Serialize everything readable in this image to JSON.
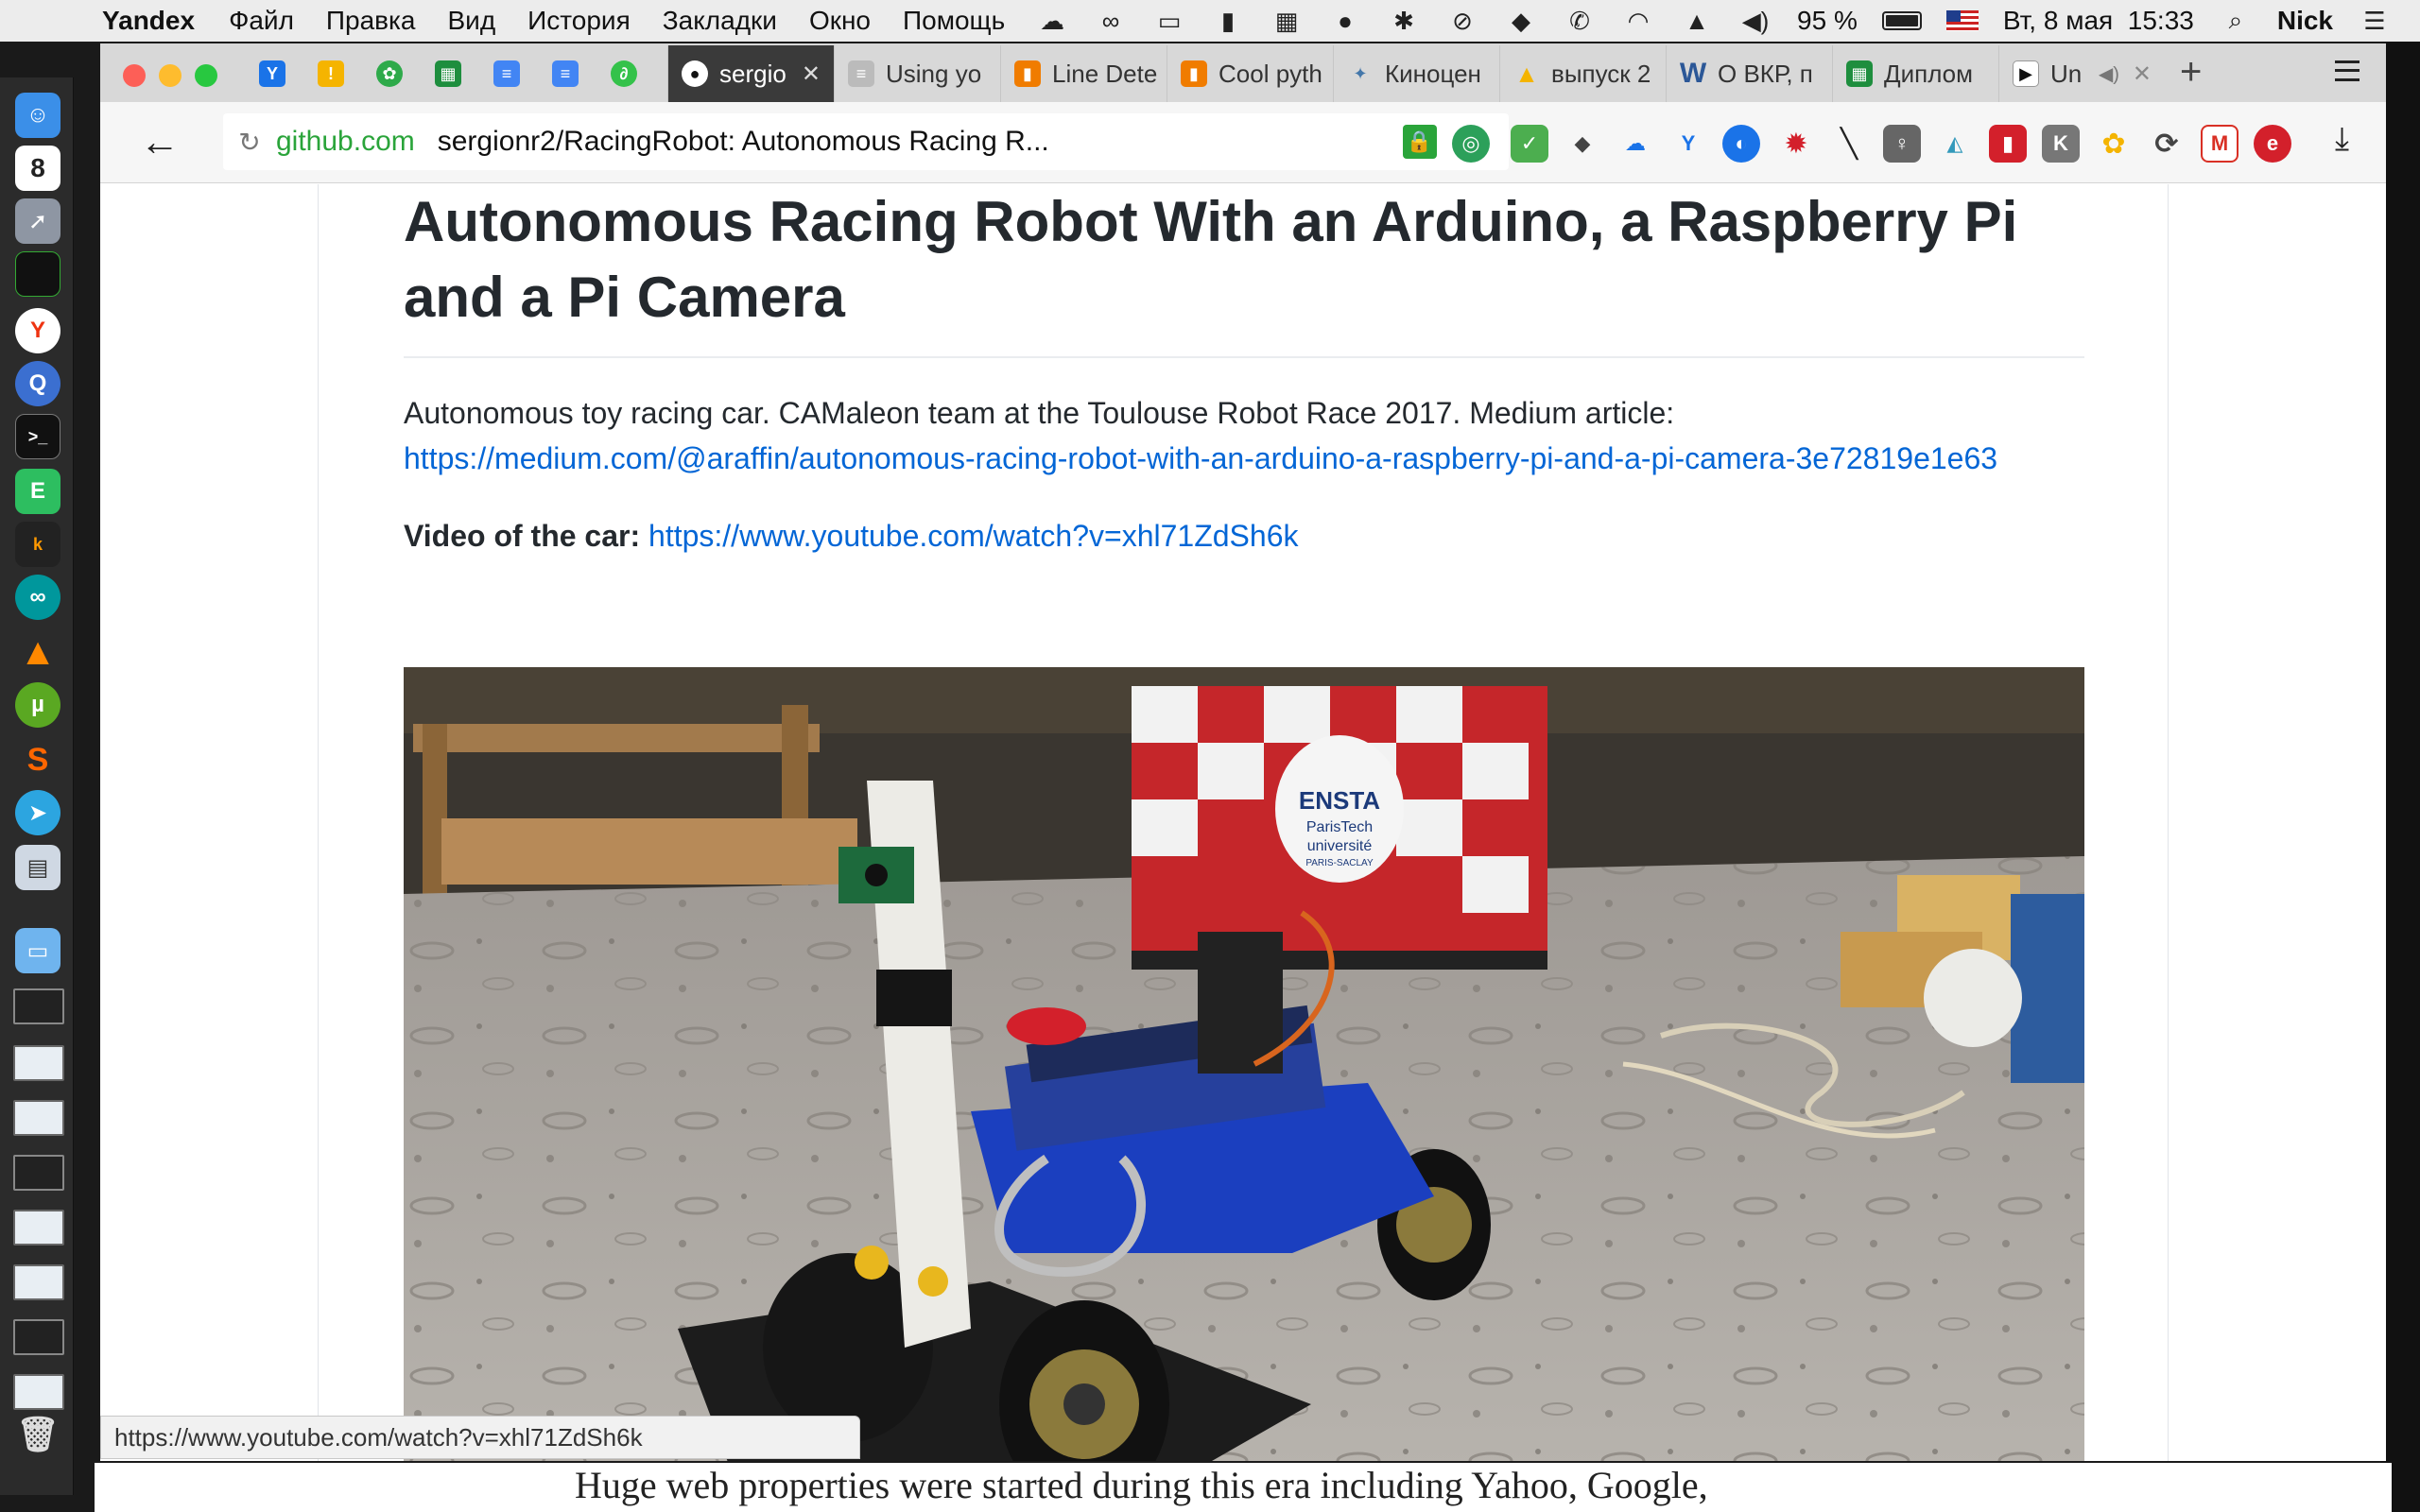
{
  "menubar": {
    "app_name": "Yandex",
    "menus": [
      "Файл",
      "Правка",
      "Вид",
      "История",
      "Закладки",
      "Окно",
      "Помощь"
    ],
    "battery": "95 %",
    "datetime": "Вт, 8 мая  15:33",
    "user": "Nick"
  },
  "dock": {
    "calendar_day": "8"
  },
  "browser": {
    "tabs": [
      {
        "title": "sergio",
        "active": true
      },
      {
        "title": "Using yo"
      },
      {
        "title": "Line Dete"
      },
      {
        "title": "Cool pyth"
      },
      {
        "title": "Киноцен"
      },
      {
        "title": "выпуск 2"
      },
      {
        "title": "О ВКР, п"
      },
      {
        "title": "Диплом"
      },
      {
        "title": "Un"
      }
    ],
    "omnibox": {
      "domain": "github.com",
      "title": "sergionr2/RacingRobot: Autonomous Racing R..."
    }
  },
  "readme": {
    "heading": "Autonomous Racing Robot With an Arduino, a Raspberry Pi and a Pi Camera",
    "intro": "Autonomous toy racing car. CAMaleon team at the Toulouse Robot Race 2017. Medium article:",
    "medium_link": "https://medium.com/@araffin/autonomous-racing-robot-with-an-arduino-a-raspberry-pi-and-a-pi-camera-3e72819e1e63",
    "video_label": "Video of the car:",
    "video_link": "https://www.youtube.com/watch?v=xhl71ZdSh6k",
    "photo_signs": {
      "school": "ENSTA",
      "school_line2": "ParisTech",
      "school_line3": "université",
      "school_line4": "PARIS-SACLAY"
    }
  },
  "status_bar": {
    "url": "https://www.youtube.com/watch?v=xhl71ZdSh6k"
  },
  "background_window": {
    "text": "Huge web properties were started during this era including Yahoo, Google,"
  }
}
